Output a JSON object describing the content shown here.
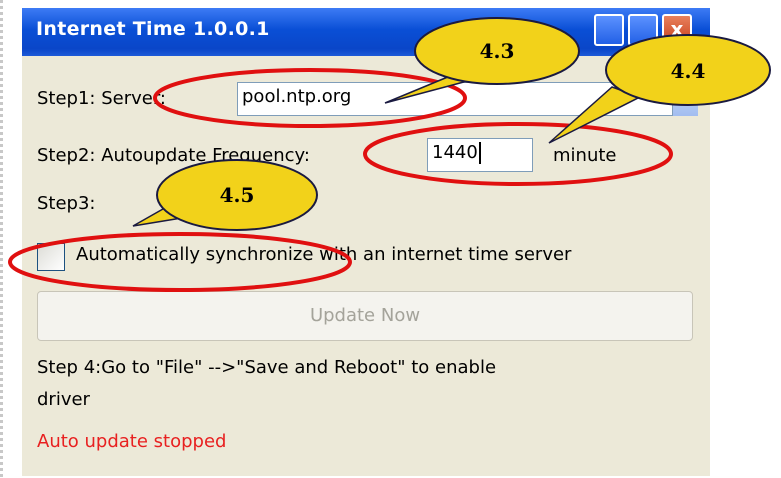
{
  "window": {
    "title": "Internet Time 1.0.0.1",
    "close_glyph": "x"
  },
  "step1": {
    "label": "Step1: Server:",
    "server_value": "pool.ntp.org"
  },
  "step2": {
    "label": "Step2: Autoupdate Frequency:",
    "frequency_value": "1440",
    "unit": "minute"
  },
  "step3": {
    "label": "Step3:",
    "checkbox_label": "Automatically synchronize with an internet time server",
    "checked": false
  },
  "update_button": {
    "label": "Update Now",
    "enabled": false
  },
  "step4": {
    "line1": "Step 4:Go to \"File\" -->\"Save and Reboot\" to enable",
    "line2": "driver"
  },
  "status": {
    "text": "Auto update stopped",
    "color": "#e82020"
  },
  "callouts": [
    {
      "label": "4.3"
    },
    {
      "label": "4.4"
    },
    {
      "label": "4.5"
    }
  ],
  "colors": {
    "titlebar": "#0a4fd6",
    "window_bg": "#ece9d8",
    "annotation_ring": "#e01010",
    "callout_fill": "#f2d21a"
  }
}
